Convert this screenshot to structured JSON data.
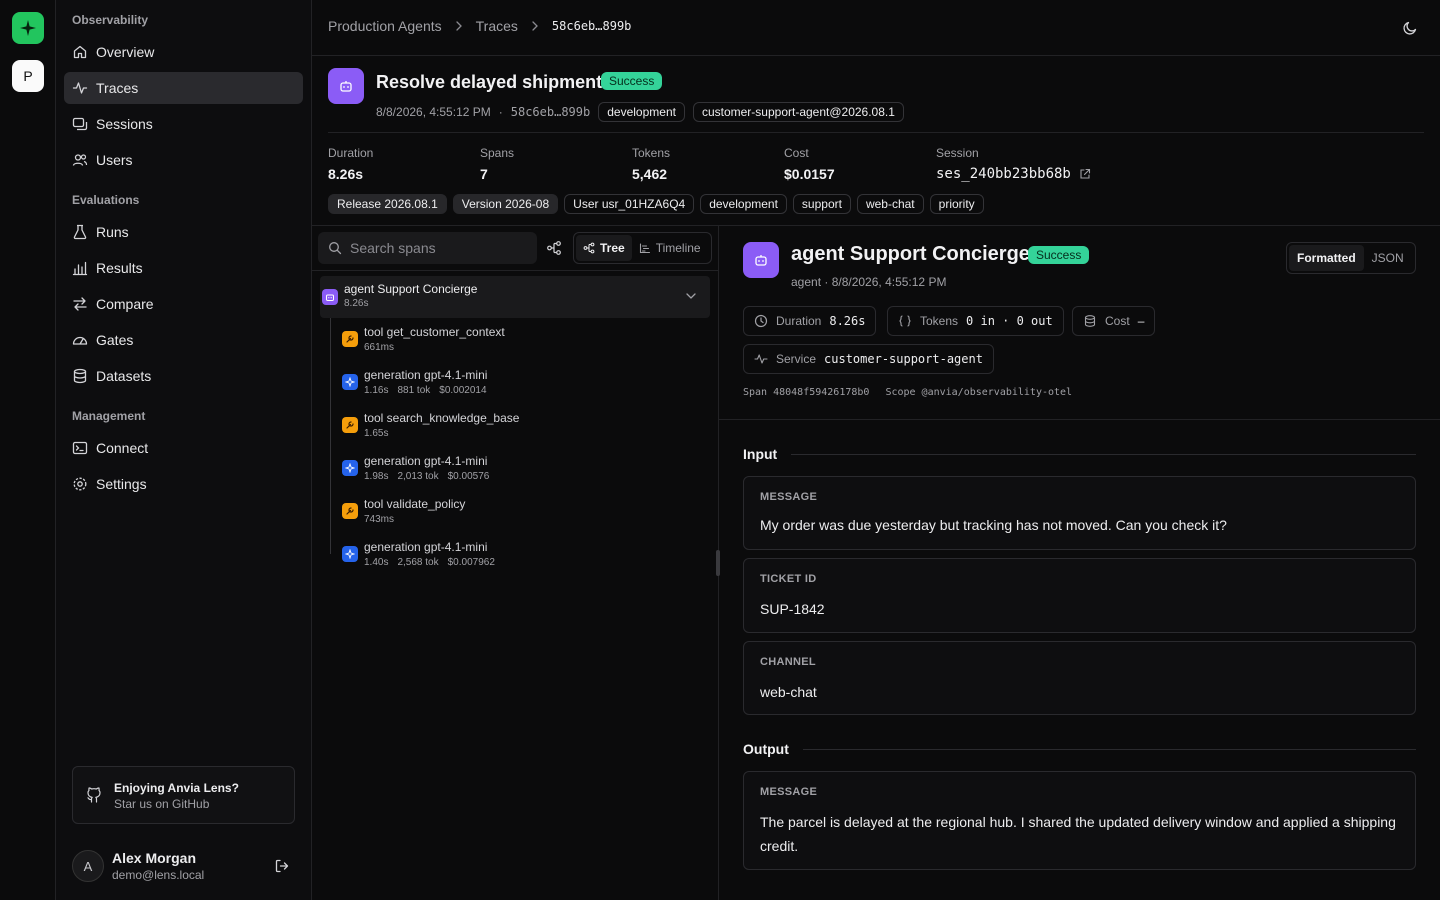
{
  "rail": {
    "project_initial": "P"
  },
  "sidebar": {
    "sections": [
      {
        "title": "Observability",
        "items": [
          "Overview",
          "Traces",
          "Sessions",
          "Users"
        ]
      },
      {
        "title": "Evaluations",
        "items": [
          "Runs",
          "Results",
          "Compare",
          "Gates",
          "Datasets"
        ]
      },
      {
        "title": "Management",
        "items": [
          "Connect",
          "Settings"
        ]
      }
    ],
    "active_item": "Traces",
    "github_card": {
      "title": "Enjoying Anvia Lens?",
      "subtitle": "Star us on GitHub"
    },
    "user": {
      "initial": "A",
      "name": "Alex Morgan",
      "email": "demo@lens.local"
    }
  },
  "header": {
    "breadcrumbs": [
      "Production Agents",
      "Traces"
    ],
    "current": "58c6eb…899b"
  },
  "trace": {
    "title": "Resolve delayed shipment",
    "status": "Success",
    "timestamp": "8/8/2026, 4:55:12 PM",
    "short_id": "58c6eb…899b",
    "environment": "development",
    "release": "customer-support-agent@2026.08.1",
    "stats": {
      "duration_label": "Duration",
      "duration": "8.26s",
      "spans_label": "Spans",
      "spans": "7",
      "tokens_label": "Tokens",
      "tokens": "5,462",
      "cost_label": "Cost",
      "cost": "$0.0157",
      "session_label": "Session",
      "session": "ses_240bb23bb68b"
    },
    "tags_filled": [
      "Release 2026.08.1",
      "Version 2026-08",
      "User usr_01HZA6Q4"
    ],
    "tags": [
      "development",
      "support",
      "web-chat",
      "priority"
    ]
  },
  "spans_panel": {
    "search_placeholder": "Search spans",
    "view_tree": "Tree",
    "view_timeline": "Timeline",
    "root": {
      "name": "agent Support Concierge",
      "duration": "8.26s"
    },
    "children": [
      {
        "kind": "tool",
        "name": "tool get_customer_context",
        "duration": "661ms",
        "tokens": "",
        "cost": ""
      },
      {
        "kind": "generation",
        "name": "generation gpt-4.1-mini",
        "duration": "1.16s",
        "tokens": "881 tok",
        "cost": "$0.002014"
      },
      {
        "kind": "tool",
        "name": "tool search_knowledge_base",
        "duration": "1.65s",
        "tokens": "",
        "cost": ""
      },
      {
        "kind": "generation",
        "name": "generation gpt-4.1-mini",
        "duration": "1.98s",
        "tokens": "2,013 tok",
        "cost": "$0.00576"
      },
      {
        "kind": "tool",
        "name": "tool validate_policy",
        "duration": "743ms",
        "tokens": "",
        "cost": ""
      },
      {
        "kind": "generation",
        "name": "generation gpt-4.1-mini",
        "duration": "1.40s",
        "tokens": "2,568 tok",
        "cost": "$0.007962"
      }
    ]
  },
  "detail": {
    "title": "agent Support Concierge",
    "status": "Success",
    "subtitle": "agent · 8/8/2026, 4:55:12 PM",
    "format_formatted": "Formatted",
    "format_json": "JSON",
    "duration_label": "Duration",
    "duration": "8.26s",
    "tokens_label": "Tokens",
    "tokens": "0 in · 0 out",
    "cost_label": "Cost",
    "cost": "–",
    "service_label": "Service",
    "service": "customer-support-agent",
    "span_id": "Span 48048f59426178b0",
    "scope": "Scope @anvia/observability-otel",
    "input_title": "Input",
    "input": [
      {
        "key": "MESSAGE",
        "value": "My order was due yesterday but tracking has not moved. Can you check it?"
      },
      {
        "key": "TICKET ID",
        "value": "SUP-1842"
      },
      {
        "key": "CHANNEL",
        "value": "web-chat"
      }
    ],
    "output_title": "Output",
    "output": [
      {
        "key": "MESSAGE",
        "value": "The parcel is delayed at the regional hub. I shared the updated delivery window and applied a shipping credit."
      }
    ]
  },
  "colors": {
    "accent_green": "#22c55e",
    "success": "#34d399",
    "agent": "#8b5cf6",
    "tool": "#f59e0b",
    "generation": "#2563eb"
  }
}
